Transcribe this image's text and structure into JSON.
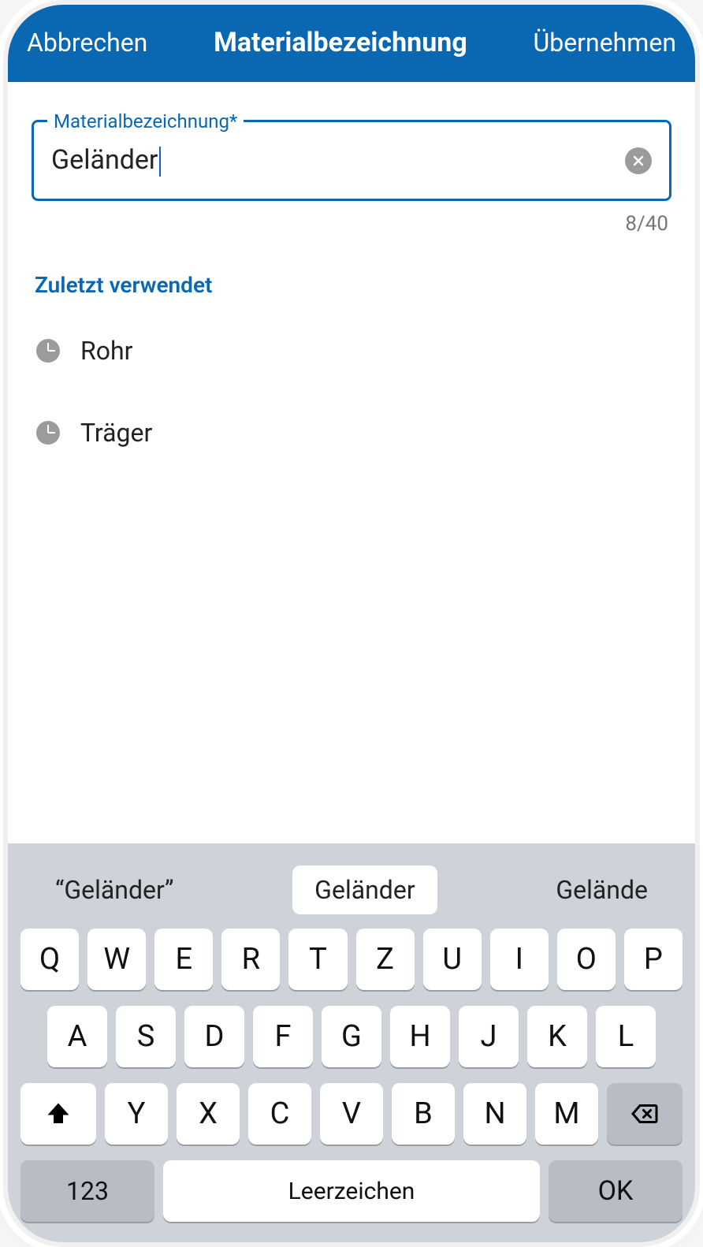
{
  "header": {
    "cancel_label": "Abbrechen",
    "title": "Materialbezeichnung",
    "accept_label": "Übernehmen"
  },
  "field": {
    "label": "Materialbezeichnung*",
    "value": "Geländer",
    "counter": "8/40"
  },
  "recent": {
    "title": "Zuletzt verwendet",
    "items": [
      "Rohr",
      "Träger"
    ]
  },
  "keyboard": {
    "suggestions": [
      "“Geländer”",
      "Geländer",
      "Gelände"
    ],
    "row1": [
      "Q",
      "W",
      "E",
      "R",
      "T",
      "Z",
      "U",
      "I",
      "O",
      "P"
    ],
    "row2": [
      "A",
      "S",
      "D",
      "F",
      "G",
      "H",
      "J",
      "K",
      "L"
    ],
    "row3": [
      "Y",
      "X",
      "C",
      "V",
      "B",
      "N",
      "M"
    ],
    "num_label": "123",
    "space_label": "Leerzeichen",
    "ok_label": "OK"
  }
}
